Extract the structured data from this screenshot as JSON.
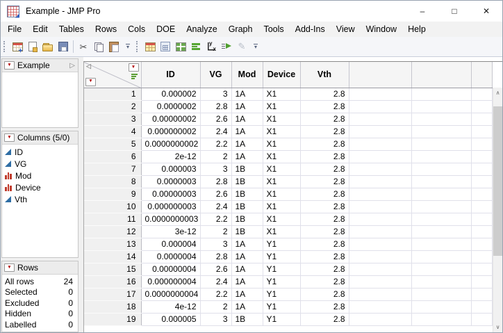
{
  "window": {
    "title": "Example - JMP Pro",
    "controls": {
      "minimize": "–",
      "maximize": "□",
      "close": "✕"
    }
  },
  "menu": {
    "items": [
      "File",
      "Edit",
      "Tables",
      "Rows",
      "Cols",
      "DOE",
      "Analyze",
      "Graph",
      "Tools",
      "Add-Ins",
      "View",
      "Window",
      "Help"
    ]
  },
  "toolbar": {
    "groups": [
      {
        "icons": [
          "new-data-table",
          "new-journal",
          "open",
          "save",
          "cut",
          "copy",
          "paste"
        ],
        "separator_after": 4
      },
      {
        "icons": [
          "data-table",
          "summary",
          "tile-windows",
          "graph-bars",
          "fit-y-by-x",
          "run-formula",
          "edit-disabled"
        ],
        "separator_after": -1
      }
    ]
  },
  "sidebar": {
    "table_panel": {
      "title": "Example"
    },
    "columns_panel": {
      "title": "Columns (5/0)",
      "items": [
        {
          "name": "ID",
          "type": "continuous"
        },
        {
          "name": "VG",
          "type": "continuous"
        },
        {
          "name": "Mod",
          "type": "nominal"
        },
        {
          "name": "Device",
          "type": "nominal"
        },
        {
          "name": "Vth",
          "type": "continuous"
        }
      ]
    },
    "rows_panel": {
      "title": "Rows",
      "stats": [
        {
          "label": "All rows",
          "value": "24"
        },
        {
          "label": "Selected",
          "value": "0"
        },
        {
          "label": "Excluded",
          "value": "0"
        },
        {
          "label": "Hidden",
          "value": "0"
        },
        {
          "label": "Labelled",
          "value": "0"
        }
      ]
    }
  },
  "table": {
    "columns": [
      "ID",
      "VG",
      "Mod",
      "Device",
      "Vth"
    ],
    "empty_columns": 3,
    "rows": [
      {
        "n": "1",
        "ID": "0.000002",
        "VG": "3",
        "Mod": "1A",
        "Device": "X1",
        "Vth": "2.8"
      },
      {
        "n": "2",
        "ID": "0.0000002",
        "VG": "2.8",
        "Mod": "1A",
        "Device": "X1",
        "Vth": "2.8"
      },
      {
        "n": "3",
        "ID": "0.00000002",
        "VG": "2.6",
        "Mod": "1A",
        "Device": "X1",
        "Vth": "2.8"
      },
      {
        "n": "4",
        "ID": "0.000000002",
        "VG": "2.4",
        "Mod": "1A",
        "Device": "X1",
        "Vth": "2.8"
      },
      {
        "n": "5",
        "ID": "0.0000000002",
        "VG": "2.2",
        "Mod": "1A",
        "Device": "X1",
        "Vth": "2.8"
      },
      {
        "n": "6",
        "ID": "2e-12",
        "VG": "2",
        "Mod": "1A",
        "Device": "X1",
        "Vth": "2.8"
      },
      {
        "n": "7",
        "ID": "0.000003",
        "VG": "3",
        "Mod": "1B",
        "Device": "X1",
        "Vth": "2.8"
      },
      {
        "n": "8",
        "ID": "0.0000003",
        "VG": "2.8",
        "Mod": "1B",
        "Device": "X1",
        "Vth": "2.8"
      },
      {
        "n": "9",
        "ID": "0.00000003",
        "VG": "2.6",
        "Mod": "1B",
        "Device": "X1",
        "Vth": "2.8"
      },
      {
        "n": "10",
        "ID": "0.000000003",
        "VG": "2.4",
        "Mod": "1B",
        "Device": "X1",
        "Vth": "2.8"
      },
      {
        "n": "11",
        "ID": "0.0000000003",
        "VG": "2.2",
        "Mod": "1B",
        "Device": "X1",
        "Vth": "2.8"
      },
      {
        "n": "12",
        "ID": "3e-12",
        "VG": "2",
        "Mod": "1B",
        "Device": "X1",
        "Vth": "2.8"
      },
      {
        "n": "13",
        "ID": "0.000004",
        "VG": "3",
        "Mod": "1A",
        "Device": "Y1",
        "Vth": "2.8"
      },
      {
        "n": "14",
        "ID": "0.0000004",
        "VG": "2.8",
        "Mod": "1A",
        "Device": "Y1",
        "Vth": "2.8"
      },
      {
        "n": "15",
        "ID": "0.00000004",
        "VG": "2.6",
        "Mod": "1A",
        "Device": "Y1",
        "Vth": "2.8"
      },
      {
        "n": "16",
        "ID": "0.000000004",
        "VG": "2.4",
        "Mod": "1A",
        "Device": "Y1",
        "Vth": "2.8"
      },
      {
        "n": "17",
        "ID": "0.0000000004",
        "VG": "2.2",
        "Mod": "1A",
        "Device": "Y1",
        "Vth": "2.8"
      },
      {
        "n": "18",
        "ID": "4e-12",
        "VG": "2",
        "Mod": "1A",
        "Device": "Y1",
        "Vth": "2.8"
      },
      {
        "n": "19",
        "ID": "0.000005",
        "VG": "3",
        "Mod": "1B",
        "Device": "Y1",
        "Vth": "2.8"
      }
    ]
  },
  "colors": {
    "red_triangle": "#b00000",
    "continuous_icon_blue": "#2e6da4",
    "nominal_icon_red": "#c03a2b",
    "toolbar_green": "#5a9e32",
    "header_bg": "#f5f5f5",
    "grid_line": "#e0e0ea"
  }
}
